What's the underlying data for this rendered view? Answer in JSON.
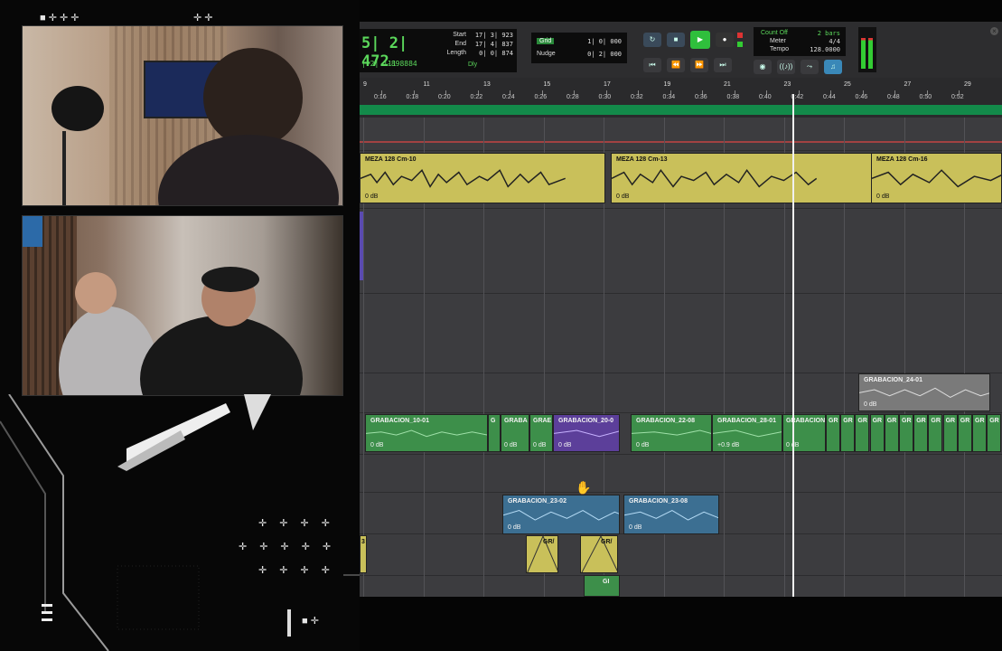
{
  "counter": {
    "main": "5| 2| 472",
    "sub": "| 2| 111",
    "offset": "-898884"
  },
  "selection": [
    {
      "label": "Start",
      "value": "17| 3| 923"
    },
    {
      "label": "End",
      "value": "17| 4| 837"
    },
    {
      "label": "Length",
      "value": "0| 0| 874"
    }
  ],
  "dly_label": "Dly",
  "grid": {
    "label": "Grid",
    "value": "1| 0| 000"
  },
  "nudge": {
    "label": "Nudge",
    "value": "0| 2| 000"
  },
  "count_off": {
    "label": "Count Off",
    "value": "2 bars"
  },
  "meter": {
    "label": "Meter",
    "value": "4/4"
  },
  "tempo": {
    "label": "Tempo",
    "value": "128.0000"
  },
  "transport": [
    "back-to-start",
    "rewind",
    "fast-forward",
    "forward-to-end"
  ],
  "bars": [
    "9",
    "11",
    "13",
    "15",
    "17",
    "19",
    "21",
    "23",
    "25",
    "27",
    "29"
  ],
  "times": [
    "0:16",
    "0:18",
    "0:20",
    "0:22",
    "0:24",
    "0:26",
    "0:28",
    "0:30",
    "0:32",
    "0:34",
    "0:36",
    "0:38",
    "0:40",
    "0:42",
    "0:44",
    "0:46",
    "0:48",
    "0:50",
    "0:52"
  ],
  "clips": {
    "meza1": {
      "name": "MEZA 128 Cm-10",
      "db": "0 dB"
    },
    "meza2": {
      "name": "MEZA 128 Cm-13",
      "db": "0 dB"
    },
    "meza3": {
      "name": "MEZA 128 Cm-16",
      "db": "0 dB"
    },
    "g24": {
      "name": "GRABACION_24-01",
      "db": "0 dB"
    },
    "g10": {
      "name": "GRABACION_10-01",
      "db": "0 dB"
    },
    "gc": {
      "name": "G",
      "db": ""
    },
    "gab": {
      "name": "GRABA",
      "db": "0 dB"
    },
    "grae": {
      "name": "GRAE",
      "db": "0 dB"
    },
    "g20": {
      "name": "GRABACION_20-0",
      "db": "0 dB"
    },
    "g22": {
      "name": "GRABACION_22-08",
      "db": "0 dB"
    },
    "g28": {
      "name": "GRABACION_28-01",
      "db": "+0.9 dB"
    },
    "gcio": {
      "name": "GRABACION",
      "db": "0 dB"
    },
    "g23a": {
      "name": "GRABACION_23-02",
      "db": "0 dB"
    },
    "g23b": {
      "name": "GRABACION_23-08",
      "db": "0 dB"
    },
    "s1": {
      "name": "GR/",
      "db": ""
    },
    "s2": {
      "name": "GR/",
      "db": ""
    },
    "s3": {
      "name": "GI",
      "db": ""
    },
    "s0": {
      "name": "3",
      "db": ""
    },
    "gr_small": [
      "GR",
      "GR",
      "GR",
      "GR",
      "GR",
      "GR",
      "GR",
      "GR",
      "GR",
      "GR",
      "GR",
      "GR"
    ]
  }
}
